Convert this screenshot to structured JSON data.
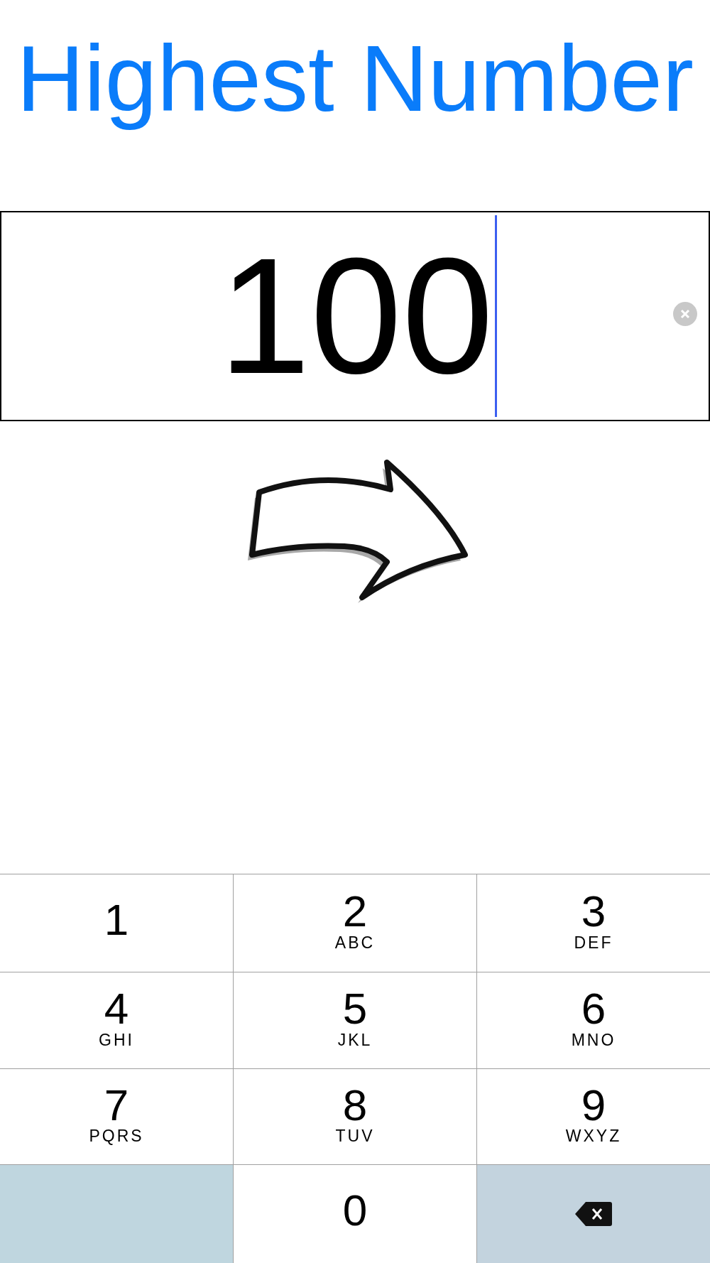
{
  "title": "Highest Number",
  "field": {
    "value": "100",
    "focused": true
  },
  "keys": [
    {
      "kind": "digit",
      "digit": "1"
    },
    {
      "kind": "digit",
      "digit": "2",
      "letters": "ABC"
    },
    {
      "kind": "digit",
      "digit": "3",
      "letters": "DEF"
    },
    {
      "kind": "digit",
      "digit": "4",
      "letters": "GHI"
    },
    {
      "kind": "digit",
      "digit": "5",
      "letters": "JKL"
    },
    {
      "kind": "digit",
      "digit": "6",
      "letters": "MNO"
    },
    {
      "kind": "digit",
      "digit": "7",
      "letters": "PQRS"
    },
    {
      "kind": "digit",
      "digit": "8",
      "letters": "TUV"
    },
    {
      "kind": "digit",
      "digit": "9",
      "letters": "WXYZ"
    },
    {
      "kind": "blank"
    },
    {
      "kind": "digit",
      "digit": "0"
    },
    {
      "kind": "delete"
    }
  ]
}
